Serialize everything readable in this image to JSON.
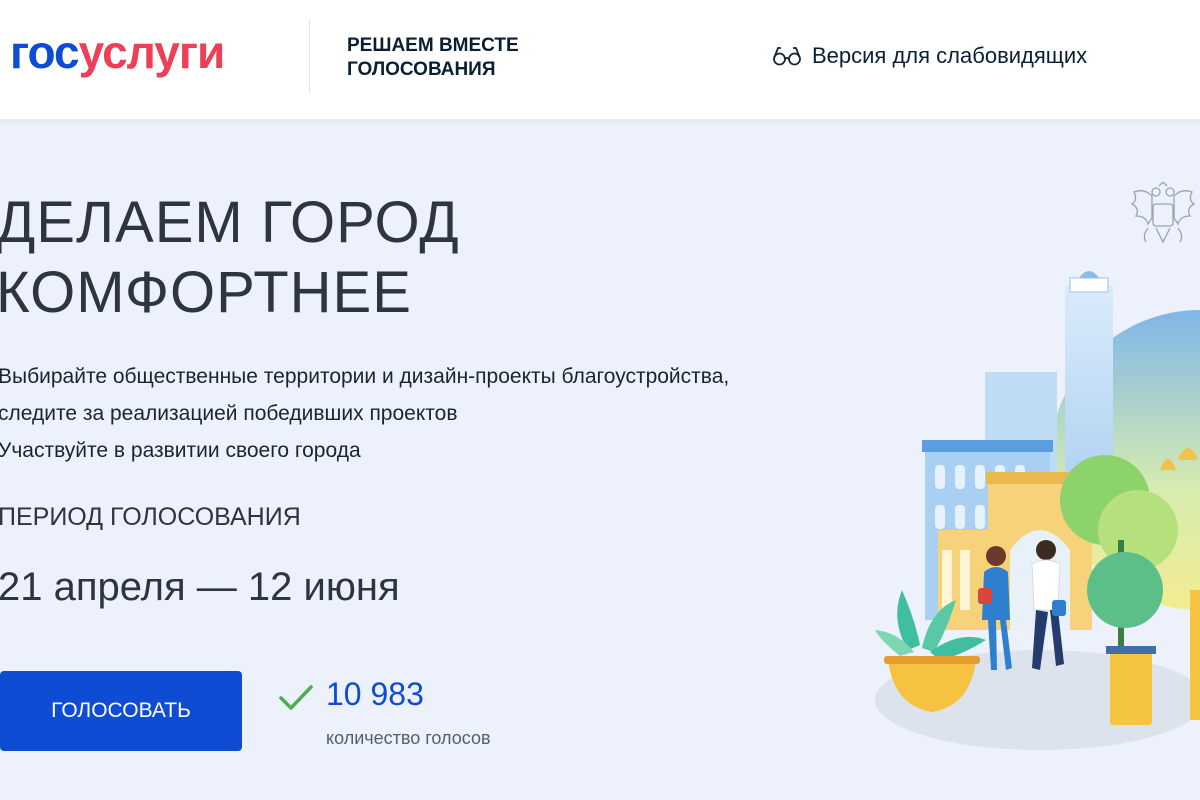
{
  "header": {
    "logo_part1": "гос",
    "logo_part2": "услуги",
    "tagline_line1": "РЕШАЕМ ВМЕСТЕ",
    "tagline_line2": "ГОЛОСОВАНИЯ",
    "accessibility_label": "Версия для слабовидящих",
    "accessibility_icon": "glasses-icon"
  },
  "hero": {
    "title_line1": "ДЕЛАЕМ ГОРОД",
    "title_line2": "КОМФОРТНЕЕ",
    "description": [
      "Выбирайте общественные территории и дизайн-проекты благоустройства,",
      "следите за реализацией победивших проектов",
      "Участвуйте в развитии своего города"
    ],
    "period_label": "ПЕРИОД ГОЛОСОВАНИЯ",
    "period_dates": "21 апреля — 12 июня",
    "vote_button_label": "ГОЛОСОВАТЬ",
    "vote_count": "10 983",
    "vote_count_label": "количество голосов",
    "check_icon": "checkmark-icon"
  },
  "illustration": {
    "emblem_icon": "coat-of-arms-icon",
    "scene": "city-park-illustration"
  },
  "colors": {
    "brand_blue": "#0d4cd3",
    "brand_red": "#ee3f58",
    "background": "#edf1fb",
    "check_green": "#4caf50"
  }
}
